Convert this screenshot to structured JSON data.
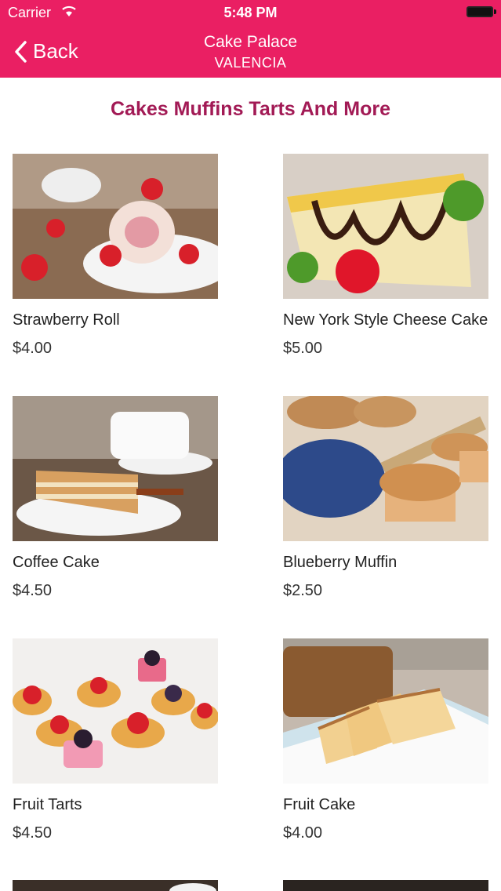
{
  "status": {
    "carrier": "Carrier",
    "time": "5:48 PM"
  },
  "nav": {
    "back": "Back",
    "title": "Cake Palace",
    "subtitle": "VALENCIA"
  },
  "section_title": "Cakes Muffins Tarts And More",
  "items": [
    {
      "name": "Strawberry Roll",
      "price": "$4.00"
    },
    {
      "name": "New York Style Cheese Cake",
      "price": "$5.00"
    },
    {
      "name": "Coffee Cake",
      "price": "$4.50"
    },
    {
      "name": "Blueberry Muffin",
      "price": "$2.50"
    },
    {
      "name": "Fruit Tarts",
      "price": "$4.50"
    },
    {
      "name": "Fruit Cake",
      "price": "$4.00"
    }
  ],
  "colors": {
    "header": "#ea1f63",
    "section_title": "#a21a55"
  }
}
